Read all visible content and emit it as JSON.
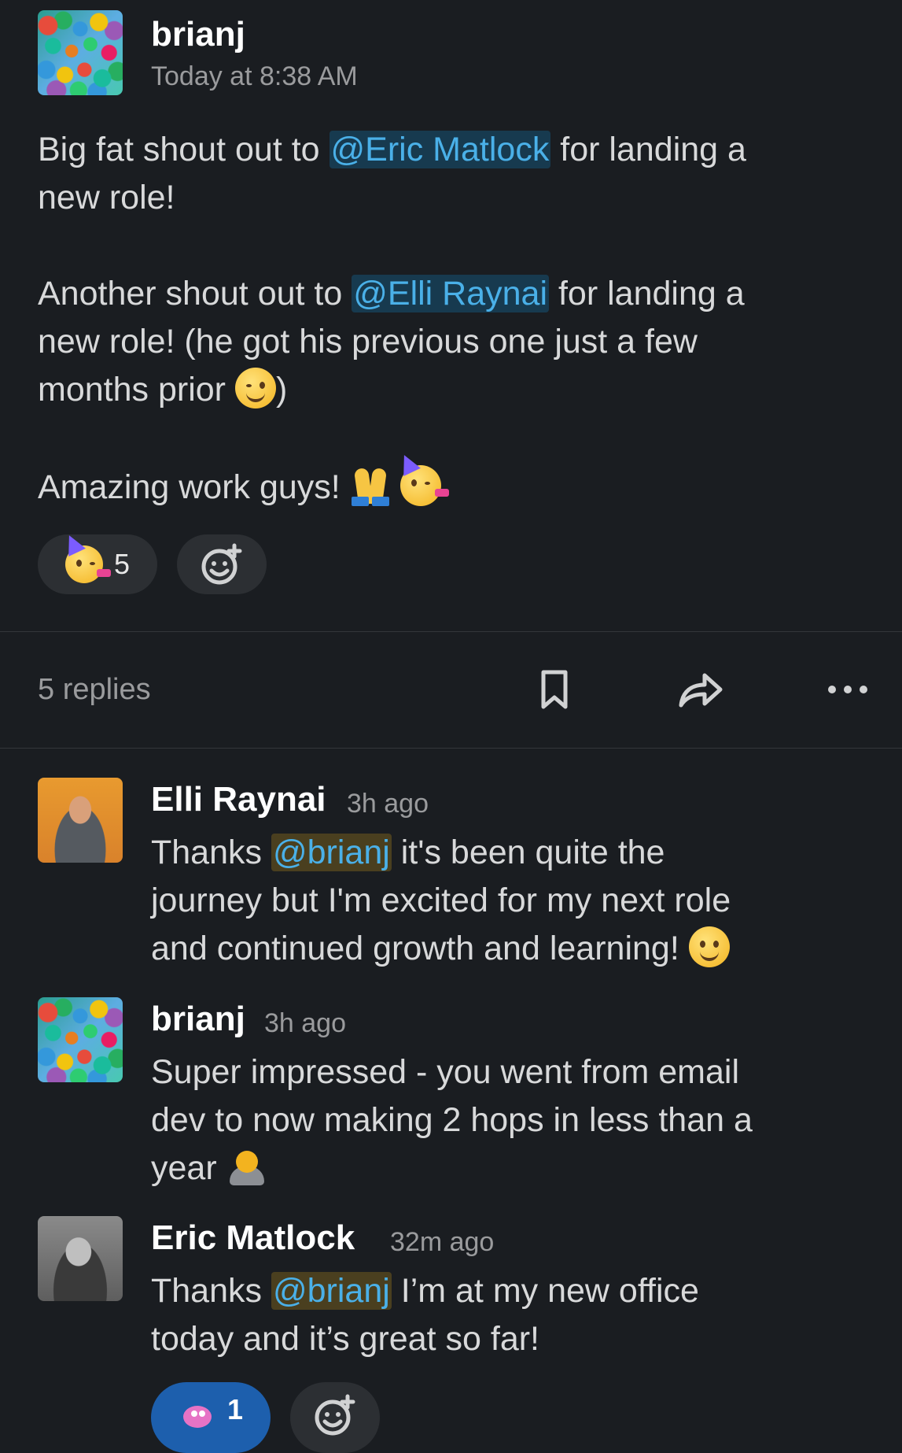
{
  "post": {
    "author": "brianj",
    "time": "Today at 8:38 AM",
    "line1_before": "Big fat shout out to ",
    "line1_mention": "@Eric Matlock",
    "line1_after": " for landing a",
    "line2": "new role!",
    "line3_before": "Another shout out to ",
    "line3_mention": "@Elli Raynai",
    "line3_after": " for landing a",
    "line4": "new role! (he got his previous one just a few",
    "line5": "months prior ",
    "line5_close": ")",
    "line6": "Amazing work guys! ",
    "reaction_count": "5"
  },
  "thread_bar": {
    "replies_label": "5 replies"
  },
  "replies": [
    {
      "author": "Elli Raynai",
      "time": "3h ago",
      "l1_before": "Thanks ",
      "l1_mention": "@brianj",
      "l1_after": " it's been quite the",
      "l2": "journey but I'm excited for my next role",
      "l3": "and continued growth and learning! "
    },
    {
      "author": "brianj",
      "time": "3h ago",
      "l1": "Super impressed - you went from email",
      "l2": "dev to now making 2 hops in less than a",
      "l3": "year "
    },
    {
      "author": "Eric Matlock",
      "time": "32m ago",
      "l1_before": "Thanks ",
      "l1_mention": "@brianj",
      "l1_after": " I’m at my new office",
      "l2": "today and it’s great so far!",
      "reaction_count": "1"
    }
  ],
  "icons": {
    "post_emoji": [
      "wink-emoji",
      "pray-emoji",
      "partying-face-emoji"
    ],
    "actions": [
      "bookmark-icon",
      "forward-icon",
      "more-icon"
    ]
  },
  "colors": {
    "background": "#1a1d21",
    "mention_text": "#4ab0e8",
    "mention_bg": "#173a4f",
    "active_reaction": "#1d5fad"
  }
}
